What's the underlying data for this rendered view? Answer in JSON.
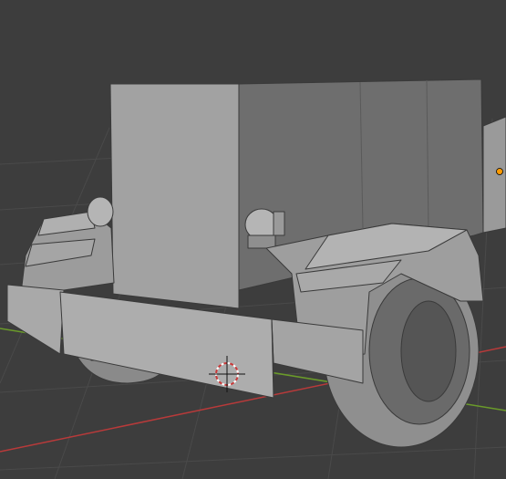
{
  "app": {
    "name": "3D Viewport",
    "background_color": "#3d3d3d"
  },
  "viewport": {
    "grid_color": "#4a4a4a",
    "x_axis_color": "#b83a3a",
    "y_axis_color": "#6a9a2a",
    "show_grid": true
  },
  "scene": {
    "object": "truck-front-model",
    "shading": "solid",
    "mesh_colors": {
      "light": "#a8a8a8",
      "mid": "#8e8e8e",
      "dark": "#6d6d6d",
      "edge": "#3a3a3a"
    },
    "selected_origin_color": "#ff9a00"
  },
  "icons": {
    "cursor": "3d-cursor-icon",
    "origin": "object-origin-icon"
  }
}
